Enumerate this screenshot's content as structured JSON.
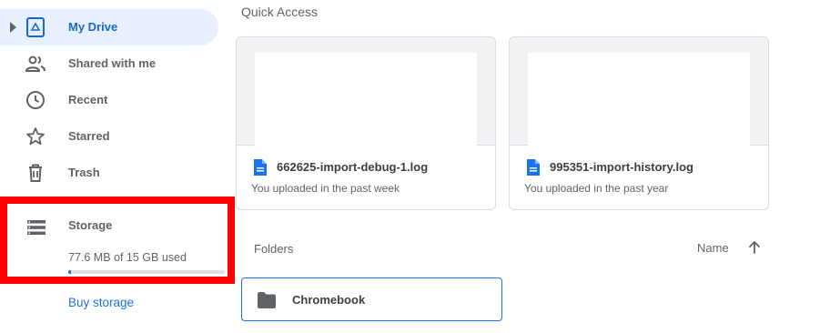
{
  "sidebar": {
    "items": [
      {
        "label": "My Drive",
        "icon": "my-drive-icon",
        "active": true
      },
      {
        "label": "Shared with me",
        "icon": "shared-icon"
      },
      {
        "label": "Recent",
        "icon": "clock-icon"
      },
      {
        "label": "Starred",
        "icon": "star-icon"
      },
      {
        "label": "Trash",
        "icon": "trash-icon"
      }
    ],
    "storage": {
      "label": "Storage",
      "used_text": "77.6 MB of 15 GB used",
      "used_fraction": 0.005
    },
    "buy_storage": "Buy storage"
  },
  "main": {
    "quick_access_title": "Quick Access",
    "cards": [
      {
        "name": "662625-import-debug-1.log",
        "sub": "You uploaded in the past week",
        "icon": "doc-icon"
      },
      {
        "name": "995351-import-history.log",
        "sub": "You uploaded in the past year",
        "icon": "doc-icon"
      }
    ],
    "folders_label": "Folders",
    "sort_label": "Name",
    "folders": [
      {
        "name": "Chromebook",
        "icon": "folder-icon"
      }
    ]
  },
  "colors": {
    "accent": "#1a73e8",
    "active_bg": "#e8f0fe",
    "highlight_border": "#ff0000"
  }
}
